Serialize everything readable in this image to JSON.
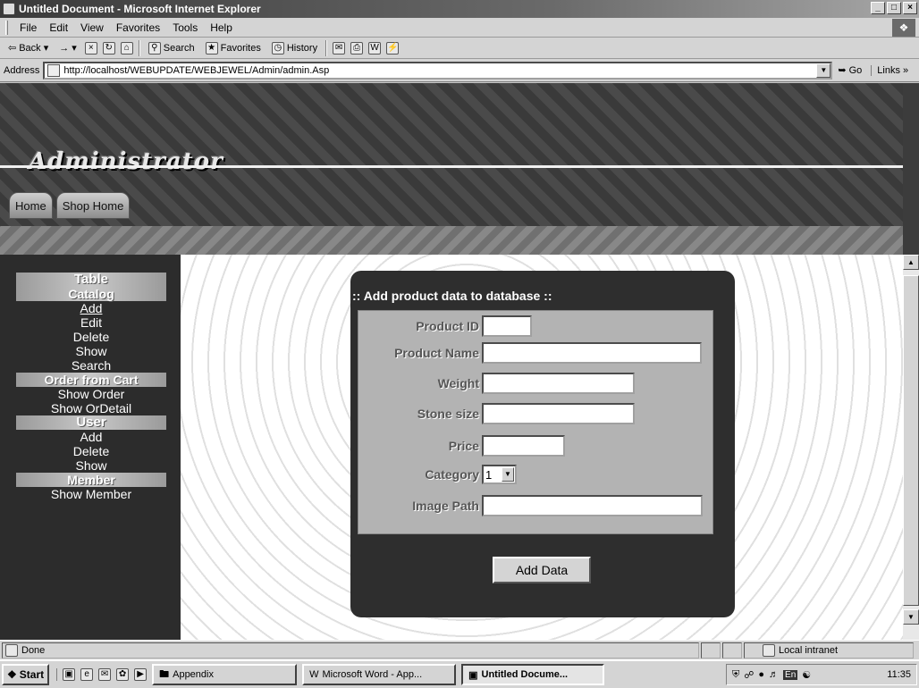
{
  "window": {
    "title": "Untitled Document - Microsoft Internet Explorer",
    "controls": [
      "_",
      "□",
      "×"
    ]
  },
  "menu": [
    "File",
    "Edit",
    "View",
    "Favorites",
    "Tools",
    "Help"
  ],
  "toolbar": {
    "back": "Back",
    "search": "Search",
    "favorites": "Favorites",
    "history": "History"
  },
  "address": {
    "label": "Address",
    "url": "http://localhost/WEBUPDATE/WEBJEWEL/Admin/admin.Asp",
    "go": "Go",
    "links": "Links »"
  },
  "site": {
    "title": "Administrator",
    "tabs": [
      "Home",
      "Shop Home"
    ]
  },
  "leftnav": {
    "table": "Table",
    "catalog": "Catalog",
    "catalog_items": [
      "Add",
      "Edit",
      "Delete",
      "Show",
      "Search"
    ],
    "order": "Order from Cart",
    "order_items": [
      "Show Order",
      "Show OrDetail"
    ],
    "user": "User",
    "user_items": [
      "Add",
      "Delete",
      "Show"
    ],
    "member": "Member",
    "member_items": [
      "Show Member"
    ]
  },
  "form": {
    "title": ":: Add product data to database ::",
    "fields": {
      "product_id": "Product ID",
      "product_name": "Product Name",
      "weight": "Weight",
      "stone_size": "Stone size",
      "price": "Price",
      "category": "Category",
      "image_path": "Image Path"
    },
    "category_value": "1",
    "submit": "Add Data"
  },
  "status": {
    "text": "Done",
    "zone": "Local intranet"
  },
  "taskbar": {
    "start": "Start",
    "tasks": [
      "Appendix",
      "Microsoft Word - App...",
      "Untitled Docume..."
    ],
    "tray_lang": "En",
    "clock": "11:35"
  }
}
